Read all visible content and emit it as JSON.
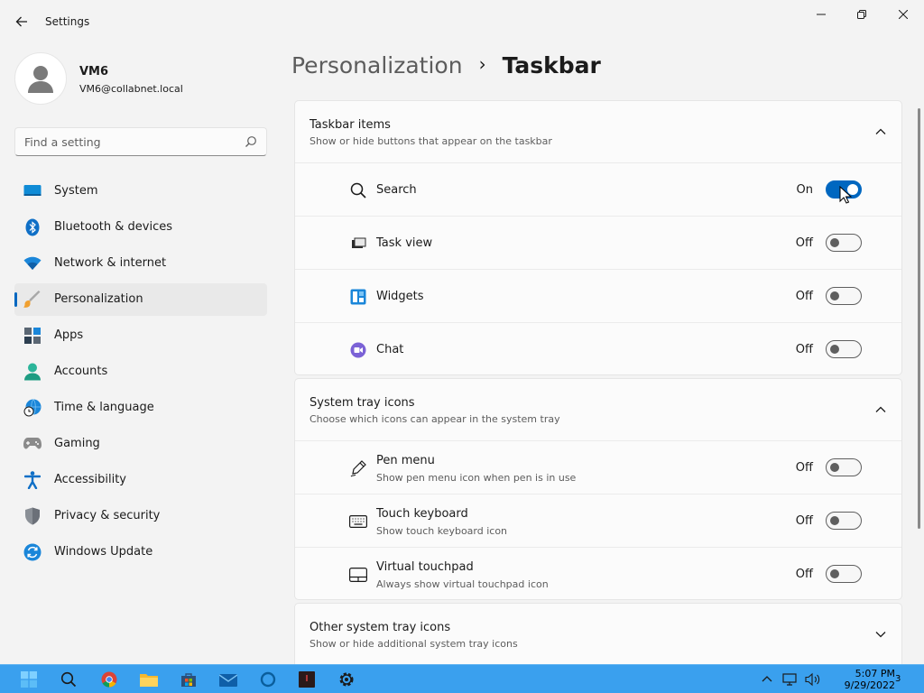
{
  "app": {
    "title": "Settings"
  },
  "profile": {
    "name": "VM6",
    "email": "VM6@collabnet.local"
  },
  "search": {
    "placeholder": "Find a setting"
  },
  "sidebar": {
    "items": [
      {
        "label": "System",
        "icon": "system-icon"
      },
      {
        "label": "Bluetooth & devices",
        "icon": "bluetooth-icon"
      },
      {
        "label": "Network & internet",
        "icon": "wifi-icon"
      },
      {
        "label": "Personalization",
        "icon": "brush-icon",
        "active": true
      },
      {
        "label": "Apps",
        "icon": "apps-icon"
      },
      {
        "label": "Accounts",
        "icon": "person-icon"
      },
      {
        "label": "Time & language",
        "icon": "globe-clock-icon"
      },
      {
        "label": "Gaming",
        "icon": "gamepad-icon"
      },
      {
        "label": "Accessibility",
        "icon": "accessibility-icon"
      },
      {
        "label": "Privacy & security",
        "icon": "shield-icon"
      },
      {
        "label": "Windows Update",
        "icon": "update-icon"
      }
    ]
  },
  "breadcrumb": {
    "parent": "Personalization",
    "separator": "›",
    "current": "Taskbar"
  },
  "sections": {
    "taskbar_items": {
      "title": "Taskbar items",
      "subtitle": "Show or hide buttons that appear on the taskbar",
      "rows": [
        {
          "label": "Search",
          "state": "On",
          "on": true,
          "icon": "search-icon"
        },
        {
          "label": "Task view",
          "state": "Off",
          "on": false,
          "icon": "task-view-icon"
        },
        {
          "label": "Widgets",
          "state": "Off",
          "on": false,
          "icon": "widgets-icon"
        },
        {
          "label": "Chat",
          "state": "Off",
          "on": false,
          "icon": "chat-icon"
        }
      ]
    },
    "system_tray": {
      "title": "System tray icons",
      "subtitle": "Choose which icons can appear in the system tray",
      "rows": [
        {
          "label": "Pen menu",
          "desc": "Show pen menu icon when pen is in use",
          "state": "Off",
          "on": false,
          "icon": "pen-icon"
        },
        {
          "label": "Touch keyboard",
          "desc": "Show touch keyboard icon",
          "state": "Off",
          "on": false,
          "icon": "keyboard-icon"
        },
        {
          "label": "Virtual touchpad",
          "desc": "Always show virtual touchpad icon",
          "state": "Off",
          "on": false,
          "icon": "touchpad-icon"
        }
      ]
    },
    "other_tray": {
      "title": "Other system tray icons",
      "subtitle": "Show or hide additional system tray icons"
    }
  },
  "taskbar": {
    "time": "5:07 PM",
    "date": "9/29/2022",
    "notification_count": "3"
  },
  "colors": {
    "accent": "#0067c0",
    "taskbar": "#3aa0ee"
  }
}
